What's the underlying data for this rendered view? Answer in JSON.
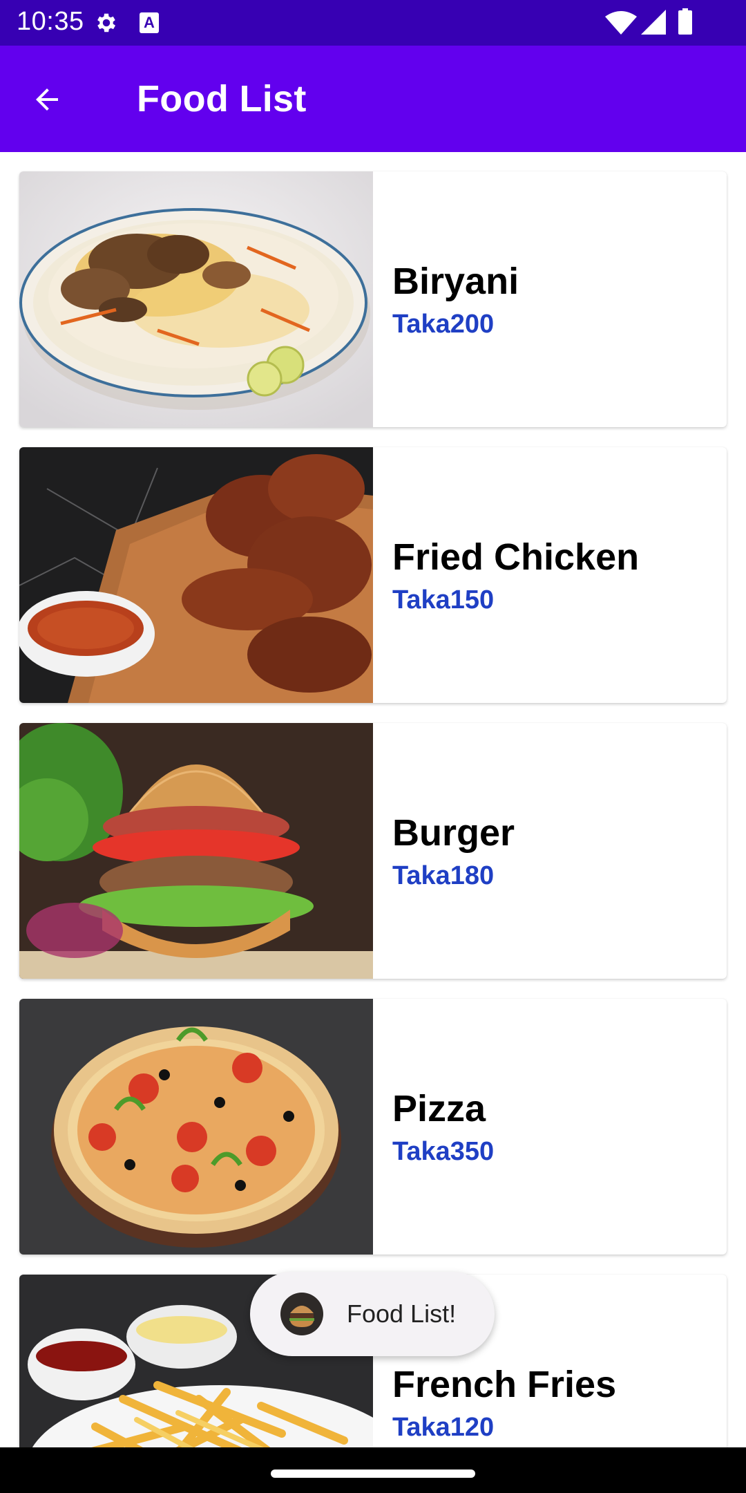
{
  "status_bar": {
    "time": "10:35",
    "icons": [
      "gear-icon",
      "keyboard-a-icon",
      "wifi-icon",
      "signal-icon",
      "battery-icon"
    ],
    "a_glyph": "A",
    "color": "#3700b3"
  },
  "app_bar": {
    "title": "Food List",
    "back_icon": "arrow-back-icon",
    "color": "#6200ee"
  },
  "foods": [
    {
      "name": "Biryani",
      "price": "Taka200",
      "image": "biryani-image"
    },
    {
      "name": "Fried Chicken",
      "price": "Taka150",
      "image": "fried-chicken-image"
    },
    {
      "name": "Burger",
      "price": "Taka180",
      "image": "burger-image"
    },
    {
      "name": "Pizza",
      "price": "Taka350",
      "image": "pizza-image"
    },
    {
      "name": "French Fries",
      "price": "Taka120",
      "image": "french-fries-image"
    }
  ],
  "toast": {
    "text": "Food List!",
    "icon": "burger-avatar-icon"
  },
  "colors": {
    "price": "#1f3fc4",
    "name": "#000000"
  }
}
